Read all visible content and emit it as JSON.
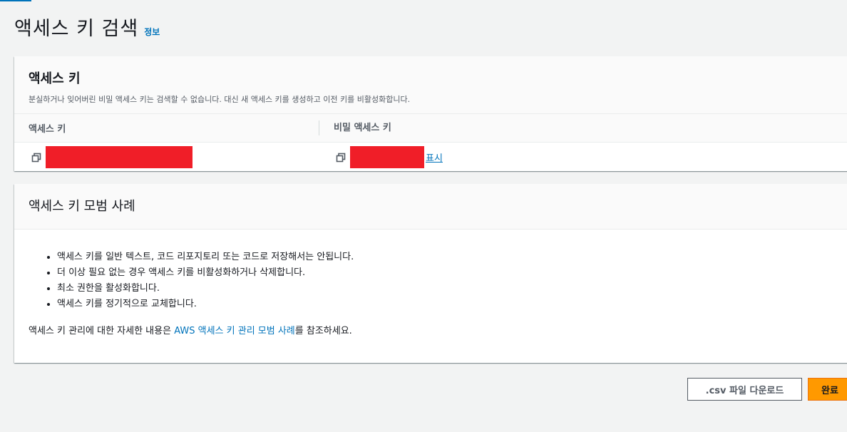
{
  "page": {
    "title": "액세스 키 검색",
    "info_link": "정보"
  },
  "access_key_panel": {
    "title": "액세스 키",
    "description": "분실하거나 잊어버린 비밀 액세스 키는 검색할 수 없습니다. 대신 새 액세스 키를 생성하고 이전 키를 비활성화합니다.",
    "columns": [
      "액세스 키",
      "비밀 액세스 키"
    ],
    "show_link": "표시"
  },
  "best_practices_panel": {
    "title": "액세스 키 모범 사례",
    "items": [
      "액세스 키를 일반 텍스트, 코드 리포지토리 또는 코드로 저장해서는 안됩니다.",
      "더 이상 필요 없는 경우 액세스 키를 비활성화하거나 삭제합니다.",
      "최소 권한을 활성화합니다.",
      "액세스 키를 정기적으로 교체합니다."
    ],
    "note_prefix": "액세스 키 관리에 대한 자세한 내용은 ",
    "note_link": "AWS 액세스 키 관리 모범 사례",
    "note_suffix": "를 참조하세요."
  },
  "actions": {
    "download_csv": ".csv 파일 다운로드",
    "done": "완료"
  },
  "colors": {
    "accent_link": "#0073bb",
    "primary_button": "#ff9900",
    "redaction": "#f01e28"
  },
  "icons": {
    "copy": "copy-icon"
  }
}
